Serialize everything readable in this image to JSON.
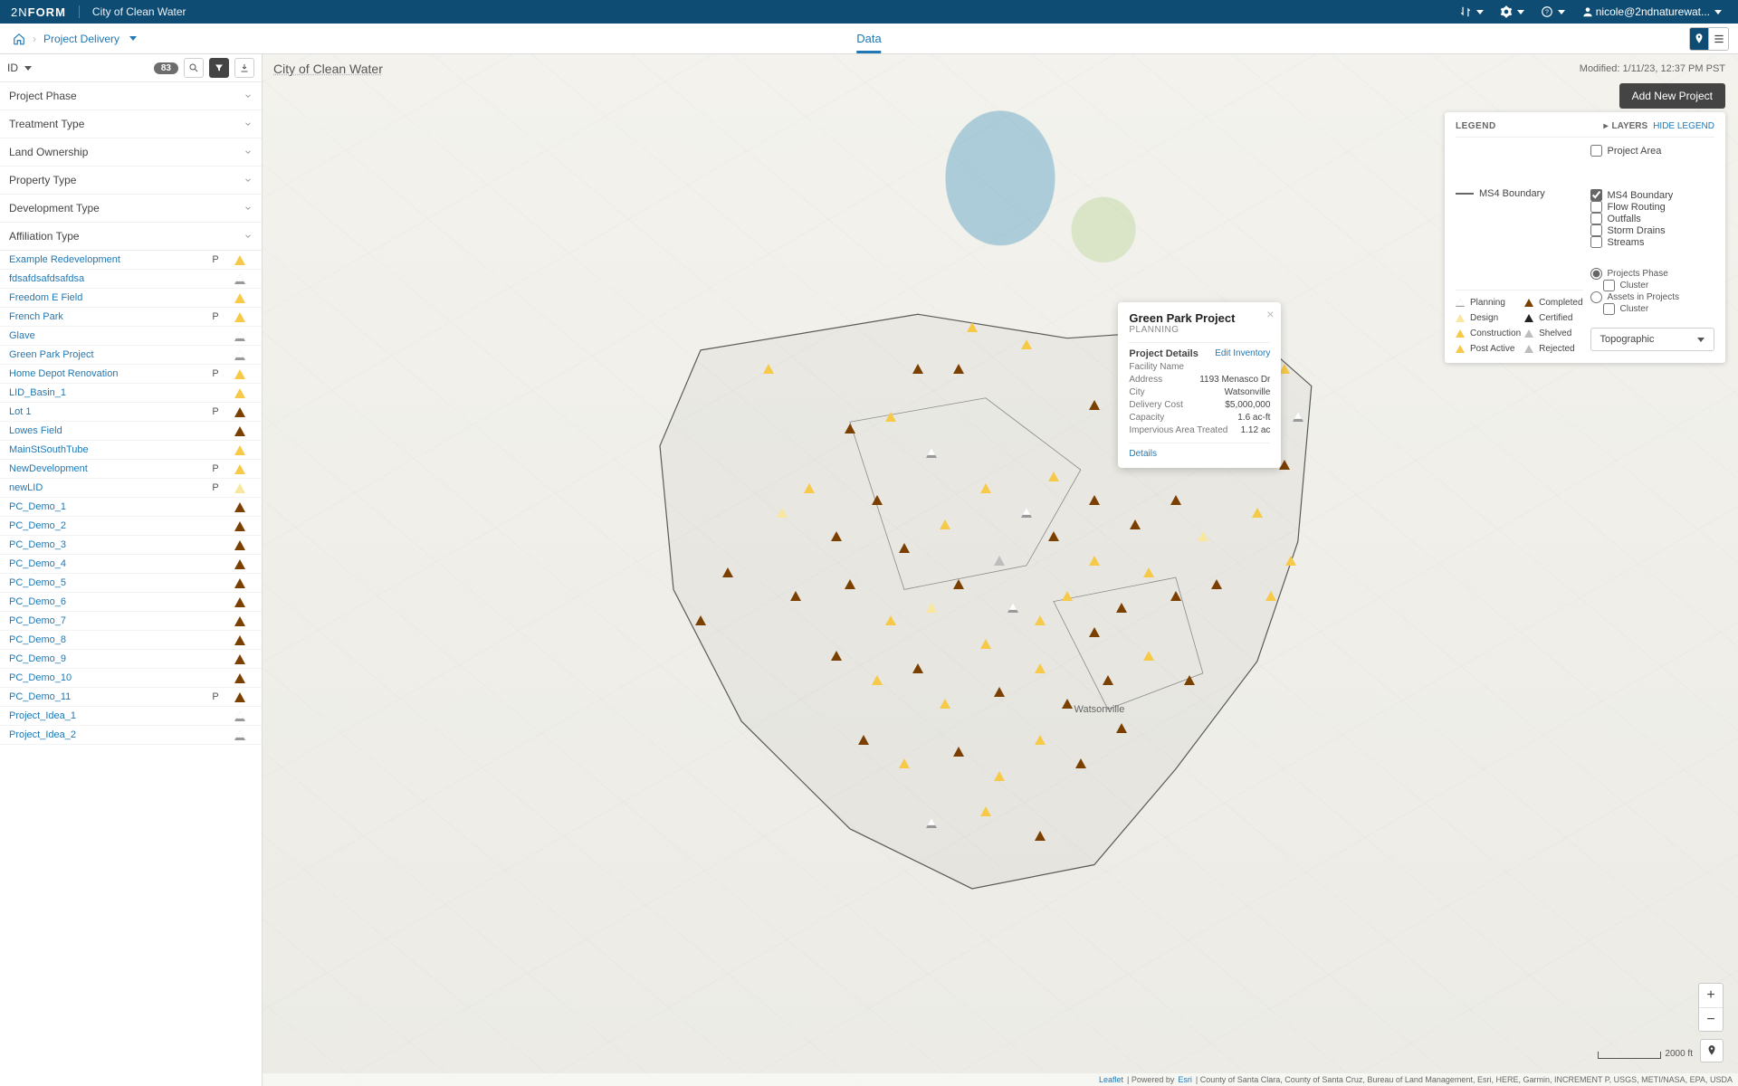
{
  "top": {
    "brand_prefix": "2N",
    "brand_suffix": "FORM",
    "app_name": "City of Clean Water",
    "user": "nicole@2ndnaturewat..."
  },
  "subbar": {
    "breadcrumb": "Project Delivery",
    "center_tab": "Data"
  },
  "id_panel": {
    "label": "ID",
    "count": "83"
  },
  "filters": [
    "Project Phase",
    "Treatment Type",
    "Land Ownership",
    "Property Type",
    "Development Type",
    "Affiliation Type"
  ],
  "projects": [
    {
      "name": "Example Redevelopment",
      "p": "P",
      "color": "yellow"
    },
    {
      "name": "fdsafdsafdsafdsa",
      "p": "",
      "color": "outline"
    },
    {
      "name": "Freedom E Field",
      "p": "",
      "color": "yellow"
    },
    {
      "name": "French Park",
      "p": "P",
      "color": "yellow"
    },
    {
      "name": "Glave",
      "p": "",
      "color": "outline"
    },
    {
      "name": "Green Park Project",
      "p": "",
      "color": "outline"
    },
    {
      "name": "Home Depot Renovation",
      "p": "P",
      "color": "yellow"
    },
    {
      "name": "LID_Basin_1",
      "p": "",
      "color": "yellow"
    },
    {
      "name": "Lot 1",
      "p": "P",
      "color": "brown"
    },
    {
      "name": "Lowes Field",
      "p": "",
      "color": "brown"
    },
    {
      "name": "MainStSouthTube",
      "p": "",
      "color": "yellow"
    },
    {
      "name": "NewDevelopment",
      "p": "P",
      "color": "yellow"
    },
    {
      "name": "newLID",
      "p": "P",
      "color": "lightyellow"
    },
    {
      "name": "PC_Demo_1",
      "p": "",
      "color": "brown"
    },
    {
      "name": "PC_Demo_2",
      "p": "",
      "color": "brown"
    },
    {
      "name": "PC_Demo_3",
      "p": "",
      "color": "brown"
    },
    {
      "name": "PC_Demo_4",
      "p": "",
      "color": "brown"
    },
    {
      "name": "PC_Demo_5",
      "p": "",
      "color": "brown"
    },
    {
      "name": "PC_Demo_6",
      "p": "",
      "color": "brown"
    },
    {
      "name": "PC_Demo_7",
      "p": "",
      "color": "brown"
    },
    {
      "name": "PC_Demo_8",
      "p": "",
      "color": "brown"
    },
    {
      "name": "PC_Demo_9",
      "p": "",
      "color": "brown"
    },
    {
      "name": "PC_Demo_10",
      "p": "",
      "color": "brown"
    },
    {
      "name": "PC_Demo_11",
      "p": "P",
      "color": "brown"
    },
    {
      "name": "Project_Idea_1",
      "p": "",
      "color": "outline"
    },
    {
      "name": "Project_Idea_2",
      "p": "",
      "color": "outline"
    }
  ],
  "map": {
    "title": "City of Clean Water",
    "timestamp": "Modified: 1/11/23, 12:37 PM PST",
    "add_new": "Add New Project",
    "city_label": "Watsonville",
    "scale_label": "2000 ft",
    "attribution_prefix": "Leaflet",
    "attribution_mid": " | Powered by ",
    "attribution_esri": "Esri",
    "attribution_rest": " | County of Santa Clara, County of Santa Cruz, Bureau of Land Management, Esri, HERE, Garmin, INCREMENT P, USGS, METI/NASA, EPA, USDA"
  },
  "popup": {
    "title": "Green Park Project",
    "status": "PLANNING",
    "section": "Project Details",
    "edit": "Edit Inventory",
    "details": "Details",
    "rows": [
      {
        "k": "Facility Name",
        "v": ""
      },
      {
        "k": "Address",
        "v": "1193 Menasco Dr"
      },
      {
        "k": "City",
        "v": "Watsonville"
      },
      {
        "k": "Delivery Cost",
        "v": "$5,000,000"
      },
      {
        "k": "Capacity",
        "v": "1.6 ac-ft"
      },
      {
        "k": "Impervious Area Treated",
        "v": "1.12 ac"
      }
    ]
  },
  "legend": {
    "header": "LEGEND",
    "layers_label": "LAYERS",
    "hide": "HIDE LEGEND",
    "boundary_label": "MS4 Boundary",
    "checkboxes_top": [
      {
        "label": "Project Area",
        "checked": false
      }
    ],
    "checkboxes_mid": [
      {
        "label": "MS4 Boundary",
        "checked": true
      },
      {
        "label": "Flow Routing",
        "checked": false
      },
      {
        "label": "Outfalls",
        "checked": false
      },
      {
        "label": "Storm Drains",
        "checked": false
      },
      {
        "label": "Streams",
        "checked": false
      }
    ],
    "phases": [
      {
        "label": "Planning",
        "color": "outline"
      },
      {
        "label": "Completed",
        "color": "brown"
      },
      {
        "label": "Design",
        "color": "lightyellow"
      },
      {
        "label": "Certified",
        "color": "black"
      },
      {
        "label": "Construction",
        "color": "yellow"
      },
      {
        "label": "Shelved",
        "color": "grey"
      },
      {
        "label": "Post Active",
        "color": "yellow"
      },
      {
        "label": "Rejected",
        "color": "grey"
      }
    ],
    "radios": [
      {
        "label": "Projects Phase",
        "indent": false,
        "checked": true
      },
      {
        "label": "Cluster",
        "indent": true,
        "checked": false
      },
      {
        "label": "Assets in Projects",
        "indent": false,
        "checked": false
      },
      {
        "label": "Cluster",
        "indent": true,
        "checked": false
      }
    ],
    "basemap": "Topographic"
  },
  "markers": [
    {
      "x": 48,
      "y": 5,
      "c": "yellow"
    },
    {
      "x": 18,
      "y": 12,
      "c": "yellow"
    },
    {
      "x": 56,
      "y": 8,
      "c": "yellow"
    },
    {
      "x": 40,
      "y": 12,
      "c": "brown"
    },
    {
      "x": 46,
      "y": 12,
      "c": "brown"
    },
    {
      "x": 66,
      "y": 18,
      "c": "brown"
    },
    {
      "x": 72,
      "y": 16,
      "c": "brown"
    },
    {
      "x": 83,
      "y": 10,
      "c": "brown"
    },
    {
      "x": 88,
      "y": 22,
      "c": "brown"
    },
    {
      "x": 94,
      "y": 28,
      "c": "brown"
    },
    {
      "x": 30,
      "y": 22,
      "c": "brown"
    },
    {
      "x": 36,
      "y": 20,
      "c": "yellow"
    },
    {
      "x": 42,
      "y": 26,
      "c": "outline"
    },
    {
      "x": 24,
      "y": 32,
      "c": "yellow"
    },
    {
      "x": 28,
      "y": 40,
      "c": "brown"
    },
    {
      "x": 20,
      "y": 36,
      "c": "lightyellow"
    },
    {
      "x": 34,
      "y": 34,
      "c": "brown"
    },
    {
      "x": 38,
      "y": 42,
      "c": "brown"
    },
    {
      "x": 44,
      "y": 38,
      "c": "yellow"
    },
    {
      "x": 50,
      "y": 32,
      "c": "yellow"
    },
    {
      "x": 52,
      "y": 44,
      "c": "grey"
    },
    {
      "x": 56,
      "y": 36,
      "c": "outline"
    },
    {
      "x": 60,
      "y": 40,
      "c": "brown"
    },
    {
      "x": 60,
      "y": 30,
      "c": "yellow"
    },
    {
      "x": 66,
      "y": 34,
      "c": "brown"
    },
    {
      "x": 66,
      "y": 44,
      "c": "yellow"
    },
    {
      "x": 72,
      "y": 38,
      "c": "brown"
    },
    {
      "x": 78,
      "y": 34,
      "c": "brown"
    },
    {
      "x": 82,
      "y": 40,
      "c": "lightyellow"
    },
    {
      "x": 90,
      "y": 36,
      "c": "yellow"
    },
    {
      "x": 95,
      "y": 44,
      "c": "yellow"
    },
    {
      "x": 12,
      "y": 46,
      "c": "brown"
    },
    {
      "x": 8,
      "y": 54,
      "c": "brown"
    },
    {
      "x": 22,
      "y": 50,
      "c": "brown"
    },
    {
      "x": 30,
      "y": 48,
      "c": "brown"
    },
    {
      "x": 36,
      "y": 54,
      "c": "yellow"
    },
    {
      "x": 42,
      "y": 52,
      "c": "lightyellow"
    },
    {
      "x": 46,
      "y": 48,
      "c": "brown"
    },
    {
      "x": 50,
      "y": 58,
      "c": "yellow"
    },
    {
      "x": 54,
      "y": 52,
      "c": "outline"
    },
    {
      "x": 58,
      "y": 54,
      "c": "yellow"
    },
    {
      "x": 62,
      "y": 50,
      "c": "yellow"
    },
    {
      "x": 66,
      "y": 56,
      "c": "brown"
    },
    {
      "x": 70,
      "y": 52,
      "c": "brown"
    },
    {
      "x": 74,
      "y": 46,
      "c": "yellow"
    },
    {
      "x": 78,
      "y": 50,
      "c": "brown"
    },
    {
      "x": 84,
      "y": 48,
      "c": "brown"
    },
    {
      "x": 92,
      "y": 50,
      "c": "yellow"
    },
    {
      "x": 28,
      "y": 60,
      "c": "brown"
    },
    {
      "x": 34,
      "y": 64,
      "c": "yellow"
    },
    {
      "x": 40,
      "y": 62,
      "c": "brown"
    },
    {
      "x": 44,
      "y": 68,
      "c": "yellow"
    },
    {
      "x": 52,
      "y": 66,
      "c": "brown"
    },
    {
      "x": 58,
      "y": 62,
      "c": "yellow"
    },
    {
      "x": 62,
      "y": 68,
      "c": "brown"
    },
    {
      "x": 68,
      "y": 64,
      "c": "brown"
    },
    {
      "x": 74,
      "y": 60,
      "c": "yellow"
    },
    {
      "x": 80,
      "y": 64,
      "c": "brown"
    },
    {
      "x": 32,
      "y": 74,
      "c": "brown"
    },
    {
      "x": 38,
      "y": 78,
      "c": "yellow"
    },
    {
      "x": 46,
      "y": 76,
      "c": "brown"
    },
    {
      "x": 52,
      "y": 80,
      "c": "yellow"
    },
    {
      "x": 58,
      "y": 74,
      "c": "yellow"
    },
    {
      "x": 64,
      "y": 78,
      "c": "brown"
    },
    {
      "x": 70,
      "y": 72,
      "c": "brown"
    },
    {
      "x": 42,
      "y": 88,
      "c": "outline"
    },
    {
      "x": 50,
      "y": 86,
      "c": "yellow"
    },
    {
      "x": 58,
      "y": 90,
      "c": "brown"
    },
    {
      "x": 96,
      "y": 20,
      "c": "outline"
    },
    {
      "x": 94,
      "y": 12,
      "c": "yellow"
    }
  ]
}
